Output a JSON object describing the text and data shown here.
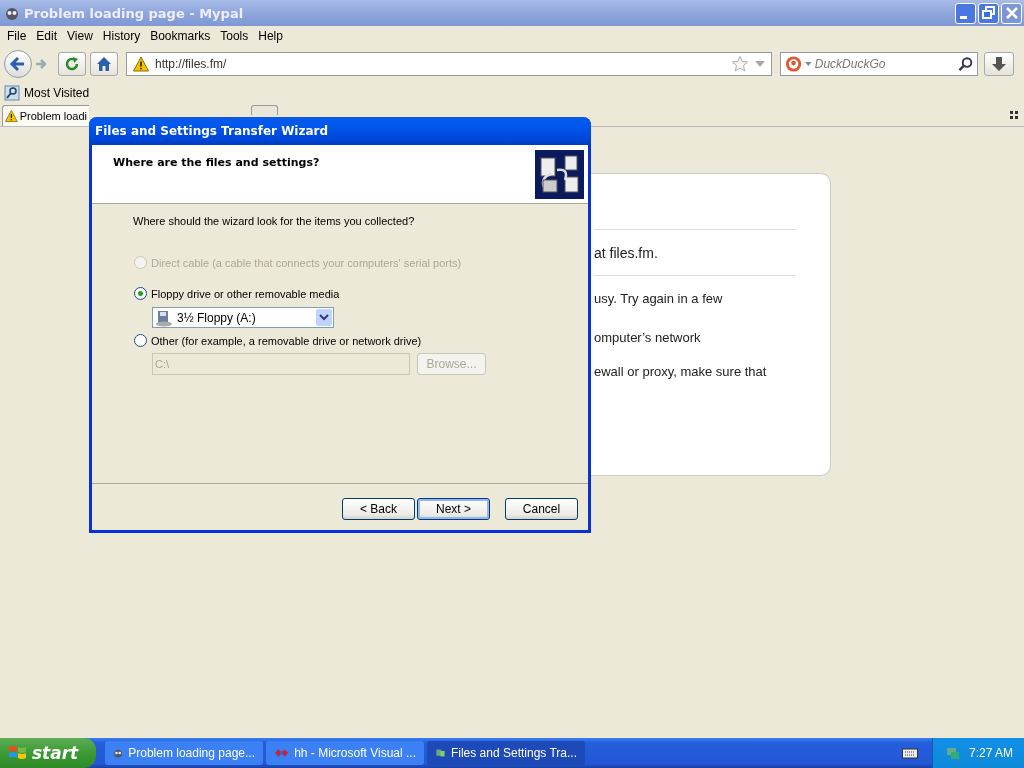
{
  "window": {
    "title": "Problem loading page - Mypal"
  },
  "menu": [
    "File",
    "Edit",
    "View",
    "History",
    "Bookmarks",
    "Tools",
    "Help"
  ],
  "toolbar": {
    "url": "http://files.fm/",
    "search": {
      "placeholder": "DuckDuckGo"
    }
  },
  "bookmarks": [
    "Most Visited"
  ],
  "tabs": [
    {
      "label": "Problem loadi",
      "selected": true
    }
  ],
  "error_page": {
    "lines": [
      "at files.fm.",
      "usy. Try again in a few",
      "omputer’s network",
      "ewall or proxy, make sure that"
    ]
  },
  "dialog": {
    "title": "Files and Settings Transfer Wizard",
    "heading": "Where are the files and settings?",
    "prompt": "Where should the wizard look for the items you collected?",
    "options": [
      {
        "label": "Direct cable (a cable that connects your computers' serial ports)",
        "selected": false,
        "disabled": true
      },
      {
        "label": "Floppy drive or other removable media",
        "selected": true,
        "disabled": false
      },
      {
        "label": "Other (for example, a removable drive or network drive)",
        "selected": false,
        "disabled": false
      }
    ],
    "drive": {
      "value": "3½ Floppy (A:)"
    },
    "path": {
      "value": "C:\\",
      "disabled": true
    },
    "browse": {
      "label": "Browse...",
      "disabled": true
    },
    "buttons": [
      {
        "label": "< Back",
        "default": false
      },
      {
        "label": "Next >",
        "default": true
      },
      {
        "label": "Cancel",
        "default": false
      }
    ]
  },
  "taskbar": {
    "start": "start",
    "tasks": [
      {
        "label": "Problem loading page...",
        "selected": false,
        "kind": "browser"
      },
      {
        "label": "hh - Microsoft Visual ...",
        "selected": false,
        "kind": "studio"
      },
      {
        "label": "Files and Settings Tra...",
        "selected": true,
        "kind": "wizard"
      }
    ],
    "clock": "7:27 AM"
  }
}
